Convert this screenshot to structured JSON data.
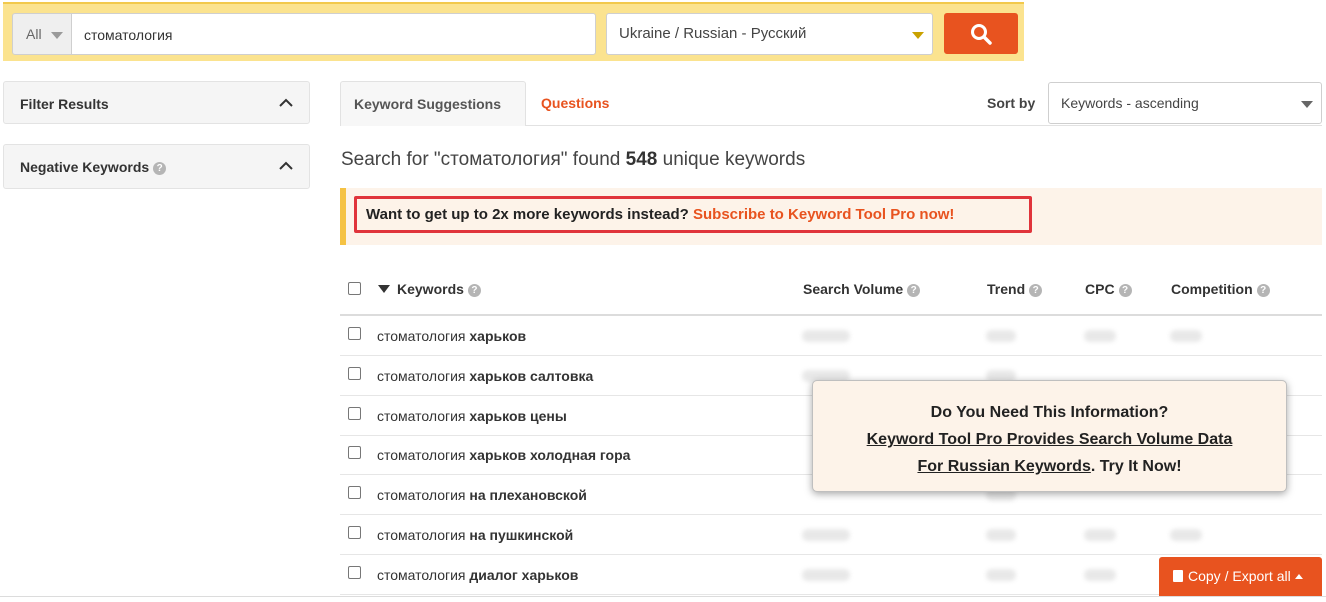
{
  "search": {
    "scope": "All",
    "query": "стоматология",
    "language": "Ukraine / Russian - Русский",
    "search_icon": "search-icon"
  },
  "sidebar": {
    "filter_title": "Filter Results",
    "negative_title": "Negative Keywords"
  },
  "tabs": {
    "active": "Keyword Suggestions",
    "second": "Questions"
  },
  "sort": {
    "label": "Sort by",
    "value": "Keywords - ascending"
  },
  "summary": {
    "prefix": "Search for \"стоматология\" found ",
    "count": "548",
    "suffix": " unique keywords"
  },
  "promo": {
    "text": "Want to get up to 2x more keywords instead? ",
    "link": "Subscribe to Keyword Tool Pro now!"
  },
  "table": {
    "headers": {
      "keywords": "Keywords",
      "volume": "Search Volume",
      "trend": "Trend",
      "cpc": "CPC",
      "competition": "Competition"
    },
    "rows": [
      {
        "base": "стоматология",
        "extra": "харьков"
      },
      {
        "base": "стоматология",
        "extra": "харьков салтовка"
      },
      {
        "base": "стоматология",
        "extra": "харьков цены"
      },
      {
        "base": "стоматология",
        "extra": "харьков холодная гора"
      },
      {
        "base": "стоматология",
        "extra": "на плехановской"
      },
      {
        "base": "стоматология",
        "extra": "на пушкинской"
      },
      {
        "base": "стоматология",
        "extra": "диалог харьков"
      }
    ]
  },
  "popup": {
    "line1": "Do You Need This Information?",
    "link1": "Keyword Tool Pro Provides Search Volume Data",
    "link2": "For Russian Keywords",
    "tail": ". Try It Now!"
  },
  "export": {
    "label": "Copy / Export all"
  },
  "colors": {
    "accent": "#e8531f",
    "banner_border": "#f5c243",
    "promo_box": "#e0343b"
  }
}
